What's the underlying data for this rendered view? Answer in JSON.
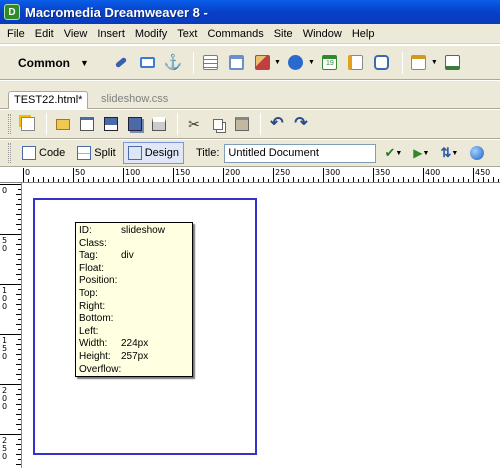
{
  "window": {
    "title": "Macromedia Dreamweaver 8 -"
  },
  "menu": [
    "File",
    "Edit",
    "View",
    "Insert",
    "Modify",
    "Text",
    "Commands",
    "Site",
    "Window",
    "Help"
  ],
  "insert_bar": {
    "category": "Common",
    "icons": [
      {
        "name": "hyperlink-icon",
        "color": "#3a5fb0"
      },
      {
        "name": "email-link-icon",
        "color": "#3a7bd5"
      },
      {
        "name": "named-anchor-icon",
        "color": "#d48a1a"
      },
      {
        "name": "table-icon",
        "color": "#5a7fc0"
      },
      {
        "name": "layer-icon",
        "color": "#6a8fd0"
      },
      {
        "name": "image-icon",
        "color": "#c04040"
      },
      {
        "name": "media-icon",
        "color": "#2a6ad0"
      },
      {
        "name": "date-icon",
        "color": "#2e8a2e"
      },
      {
        "name": "server-side-include-icon",
        "color": "#e0a020"
      },
      {
        "name": "comment-icon",
        "color": "#3a6ab0"
      },
      {
        "name": "head-icon",
        "color": "#d09a20"
      },
      {
        "name": "script-icon",
        "color": "#3a7a3a"
      }
    ]
  },
  "tabs": [
    {
      "label": "TEST22.html*",
      "active": true
    },
    {
      "label": "slideshow.css",
      "active": false
    }
  ],
  "standard_toolbar": {
    "icons": [
      "new-document-icon",
      "open-icon",
      "browse-bridge-icon",
      "save-icon",
      "save-all-icon",
      "print-icon",
      "cut-icon",
      "copy-icon",
      "paste-icon",
      "undo-icon",
      "redo-icon"
    ]
  },
  "document_toolbar": {
    "code_label": "Code",
    "split_label": "Split",
    "design_label": "Design",
    "title_label": "Title:",
    "title_value": "Untitled Document"
  },
  "ruler": {
    "top_labels": [
      "0",
      "50",
      "100",
      "150",
      "200",
      "250",
      "300",
      "350",
      "400",
      "450"
    ],
    "left_labels": [
      "0",
      "50",
      "100",
      "150",
      "200",
      "250"
    ]
  },
  "tooltip": {
    "rows": [
      {
        "label": "ID:",
        "value": "slideshow"
      },
      {
        "label": "Class:",
        "value": ""
      },
      {
        "label": "Tag:",
        "value": "div"
      },
      {
        "label": "Float:",
        "value": ""
      },
      {
        "label": "Position:",
        "value": ""
      },
      {
        "label": "Top:",
        "value": ""
      },
      {
        "label": "Right:",
        "value": ""
      },
      {
        "label": "Bottom:",
        "value": ""
      },
      {
        "label": "Left:",
        "value": ""
      },
      {
        "label": "Width:",
        "value": "224px"
      },
      {
        "label": "Height:",
        "value": "257px"
      },
      {
        "label": "Overflow:",
        "value": ""
      }
    ]
  }
}
